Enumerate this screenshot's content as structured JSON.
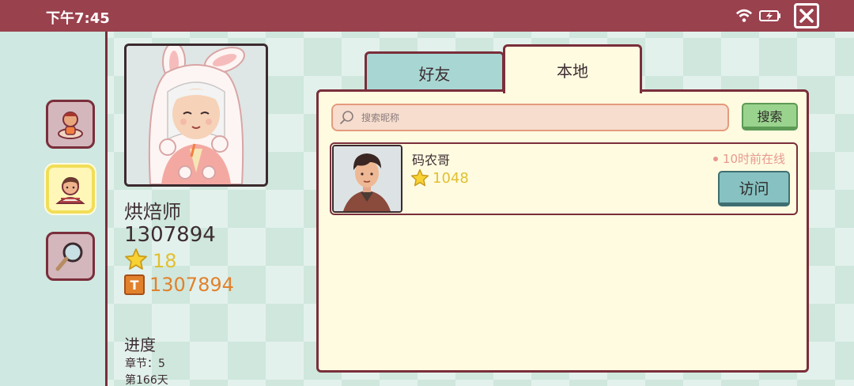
{
  "status_bar": {
    "time": "下午7:45"
  },
  "icons": {
    "wifi": "wifi-icon",
    "battery": "battery-charging-icon",
    "close": "close-icon",
    "search": "search-icon",
    "star": "star-icon",
    "coin": "coin-icon"
  },
  "sidebar": {
    "items": [
      {
        "icon": "chef-icon",
        "active": false
      },
      {
        "icon": "boy-avatar-icon",
        "active": true
      },
      {
        "icon": "magnifier-icon",
        "active": false
      }
    ]
  },
  "profile": {
    "name": "烘焙师",
    "id": "1307894",
    "stars": "18",
    "coins": "1307894",
    "coin_glyph": "T",
    "progress_heading": "进度",
    "chapter": "章节：5",
    "day": "第166天"
  },
  "tabs": [
    {
      "label": "好友",
      "active": false
    },
    {
      "label": "本地",
      "active": true
    }
  ],
  "search": {
    "placeholder": "搜索昵称",
    "value": "",
    "button_label": "搜索"
  },
  "users": [
    {
      "name": "码农哥",
      "stars": "1048",
      "online_status": "10时前在线",
      "visit_label": "访问"
    }
  ],
  "colors": {
    "status_bar": "#9a414e",
    "frame": "#7a2e3b",
    "panel_bg": "#fefbe0",
    "star": "#e1c030",
    "coin": "#e2812c",
    "online": "#e79990",
    "search_button": "#9ad38e",
    "visit_button": "#87c1c1"
  }
}
